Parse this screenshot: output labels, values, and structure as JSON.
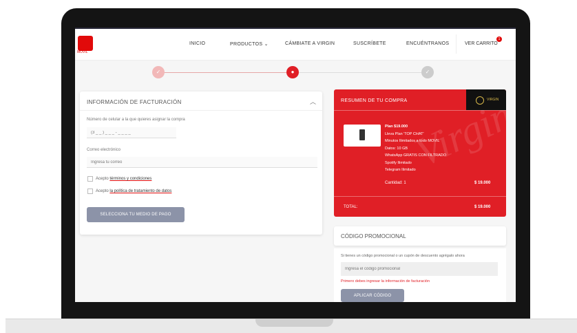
{
  "nav": {
    "logo_sub": "MÓVIL",
    "items": [
      "INICIO",
      "PRODUCTOS",
      "CÁMBIATE A VIRGIN",
      "SUSCRÍBETE",
      "ENCUÉNTRANOS"
    ],
    "products_chevron": "⌄",
    "cart_label": "VER CARRITO",
    "cart_count": "1"
  },
  "stepper": {
    "steps": [
      "✓",
      "●",
      "✓"
    ],
    "active_index": 1
  },
  "billing": {
    "title": "INFORMACIÓN DE FACTURACIÓN",
    "phone_label": "Número de celular a la que quieres asignar la compra",
    "phone_placeholder": "(3 _ _ ) _ _ _ - _ _ _ _",
    "email_label": "Correo electrónico",
    "email_placeholder": "Ingresa tu correo",
    "terms_prefix": "Acepto",
    "terms_link": "términos y condiciones",
    "policy_prefix": "Acepto",
    "policy_link": "la política de tratamiento de datos",
    "submit_button": "SELECCIONA TU MEDIO DE PAGO"
  },
  "summary": {
    "title": "RESUMEN DE TU COMPRA",
    "badge_text": "VIRGIN",
    "watermark": "Virgin",
    "product_details": [
      "Plan $19.000",
      "Lleva Plan 'TOP CHAT'",
      "Minutos Ilimitados a todo MOVIL",
      "Datos: 10 GB",
      "WhatsApp GRATIS CON FILTRADO",
      "Spotify Ilimitado",
      "Telegram Ilimitado"
    ],
    "quantity_label": "Cantidad: 1",
    "quantity_price": "$ 19.000",
    "total_label": "TOTAL:",
    "total_price": "$ 19.000"
  },
  "promo": {
    "title": "CÓDIGO PROMOCIONAL",
    "description": "Si tienes un código promocional o un cupón de descuento agrégalo ahora",
    "placeholder": "Ingresa el código promocional",
    "error": "Primero debes ingresar la información de facturación",
    "apply_button": "APLICAR CÓDIGO"
  },
  "colors": {
    "brand_red": "#e01f26",
    "button_gray": "#8c93a8",
    "badge_gold": "#d8b84a"
  }
}
